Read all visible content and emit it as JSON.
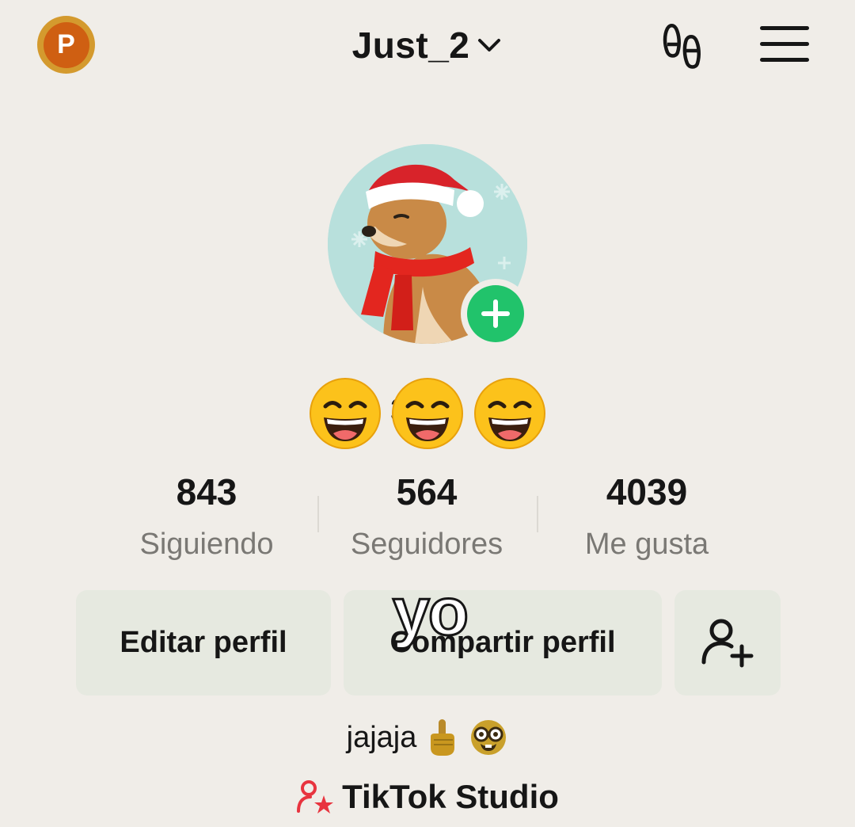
{
  "header": {
    "premium_badge": "P",
    "username": "Just_2",
    "icons": [
      "chevron-down-icon",
      "footprint-icon",
      "menu-icon"
    ]
  },
  "profile": {
    "nickname_partial": "s 3",
    "nickname_emojis": [
      "grinning-face",
      "grinning-face",
      "grinning-face"
    ]
  },
  "stats": [
    {
      "value": "843",
      "label": "Siguiendo"
    },
    {
      "value": "564",
      "label": "Seguidores"
    },
    {
      "value": "4039",
      "label": "Me gusta"
    }
  ],
  "actions": {
    "edit_label": "Editar perfil",
    "share_label": "Compartir perfil",
    "add_friend_icon": "add-user-icon"
  },
  "overlay_text": "yo",
  "bio": {
    "text": "jajaja",
    "emojis": [
      "index-pointing-up",
      "nerd-face"
    ]
  },
  "studio": {
    "label": "TikTok Studio"
  },
  "colors": {
    "background": "#f0ede8",
    "button_bg": "#e6e9e0",
    "add_green": "#21c36b",
    "studio_red": "#e8343f",
    "premium_orange": "#cf5f12"
  }
}
